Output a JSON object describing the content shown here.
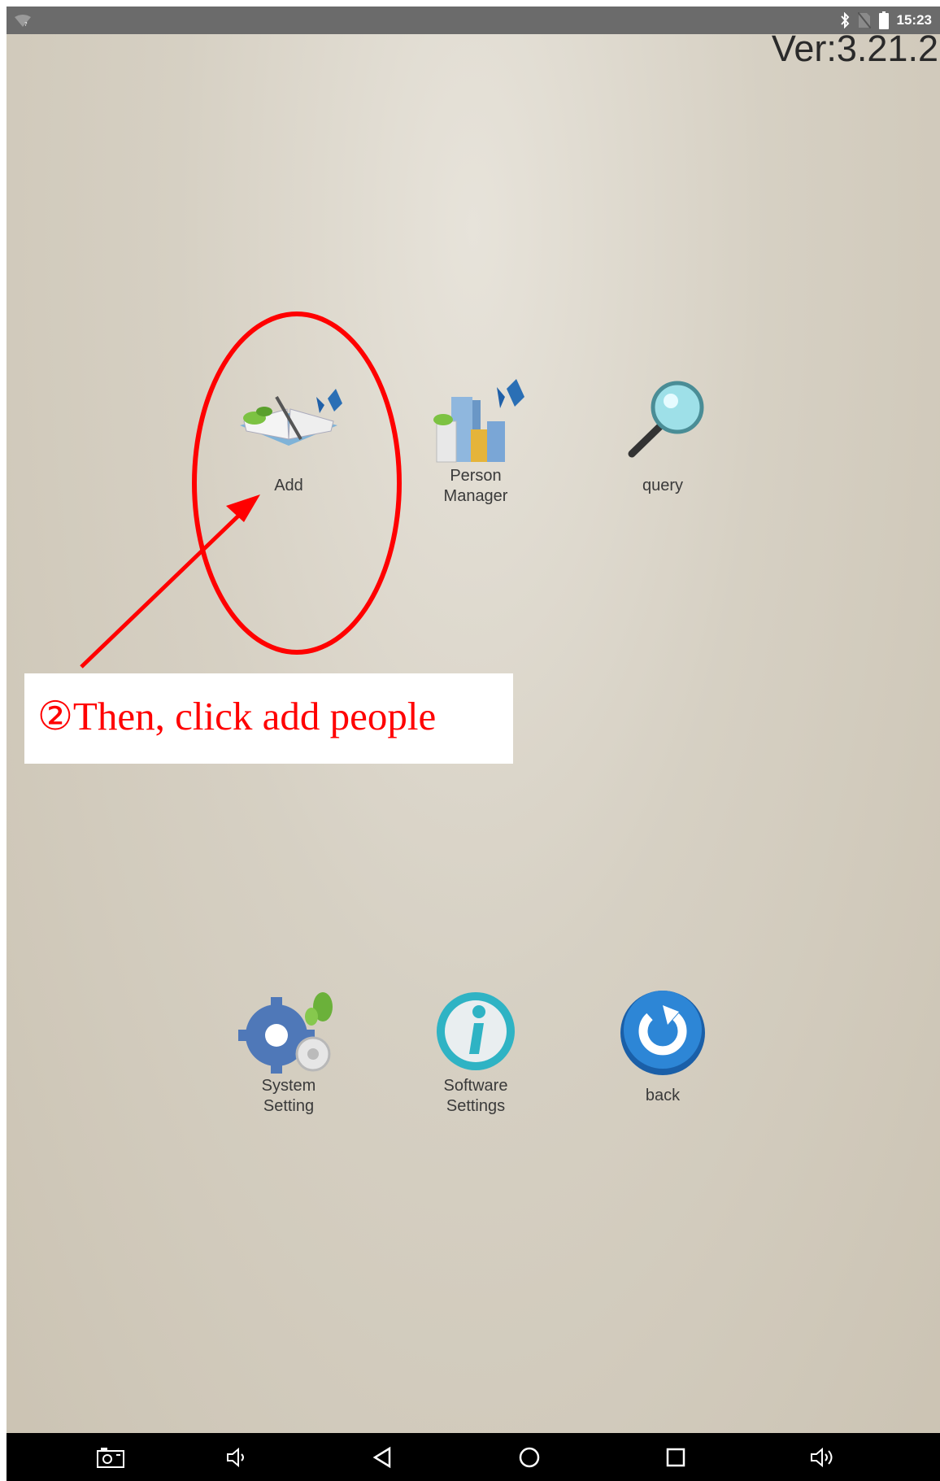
{
  "status_bar": {
    "time": "15:23",
    "icons": [
      "wifi-icon",
      "bluetooth-icon",
      "no-sim-icon",
      "battery-icon"
    ]
  },
  "version": "Ver:3.21.2",
  "apps_row1": [
    {
      "label_lines": [
        "Add"
      ],
      "icon": "book-pen-icon"
    },
    {
      "label_lines": [
        "Person",
        "Manager"
      ],
      "icon": "bar-blocks-icon"
    },
    {
      "label_lines": [
        "query"
      ],
      "icon": "magnifier-icon"
    }
  ],
  "apps_row2": [
    {
      "label_lines": [
        "System",
        "Setting"
      ],
      "icon": "gears-icon"
    },
    {
      "label_lines": [
        "Software",
        "Settings"
      ],
      "icon": "info-icon"
    },
    {
      "label_lines": [
        "back"
      ],
      "icon": "refresh-back-icon"
    }
  ],
  "annotation": {
    "text": "②Then, click add people",
    "color": "#ff0000"
  },
  "nav_bar": {
    "icons": [
      "screenshot-icon",
      "volume-down-icon",
      "back-icon",
      "home-icon",
      "recents-icon",
      "volume-up-icon"
    ]
  }
}
